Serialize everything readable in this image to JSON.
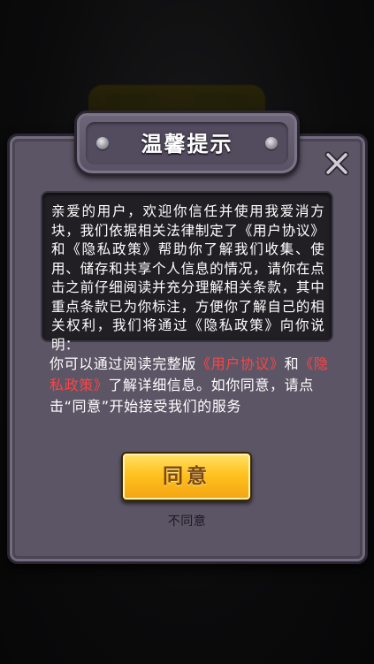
{
  "dialog": {
    "title": "温馨提示",
    "notice": "亲爱的用户，欢迎你信任并使用我爱消方块，我们依据相关法律制定了《用户协议》和《隐私政策》帮助你了解我们收集、使用、储存和共享个人信息的情况，请你在点击之前仔细阅读并充分理解相关条款，其中重点条款已为你标注，方便你了解自己的相关权利，我们将通过《隐私政策》向你说明：",
    "detail": {
      "prefix": "你可以通过阅读完整版",
      "user_agreement_link": "《用户协议》",
      "and": "和",
      "privacy_policy_link": "《隐私政策》",
      "suffix": "了解详细信息。如你同意，请点击“同意”开始接受我们的服务"
    },
    "agree_label": "同意",
    "disagree_label": "不同意",
    "close_icon": "close-x-icon"
  },
  "colors": {
    "panel": "#5c5566",
    "notice_box": "#211f24",
    "link": "#ff4343",
    "button_gold": "#ffc21f",
    "button_text": "#7c4a12"
  }
}
